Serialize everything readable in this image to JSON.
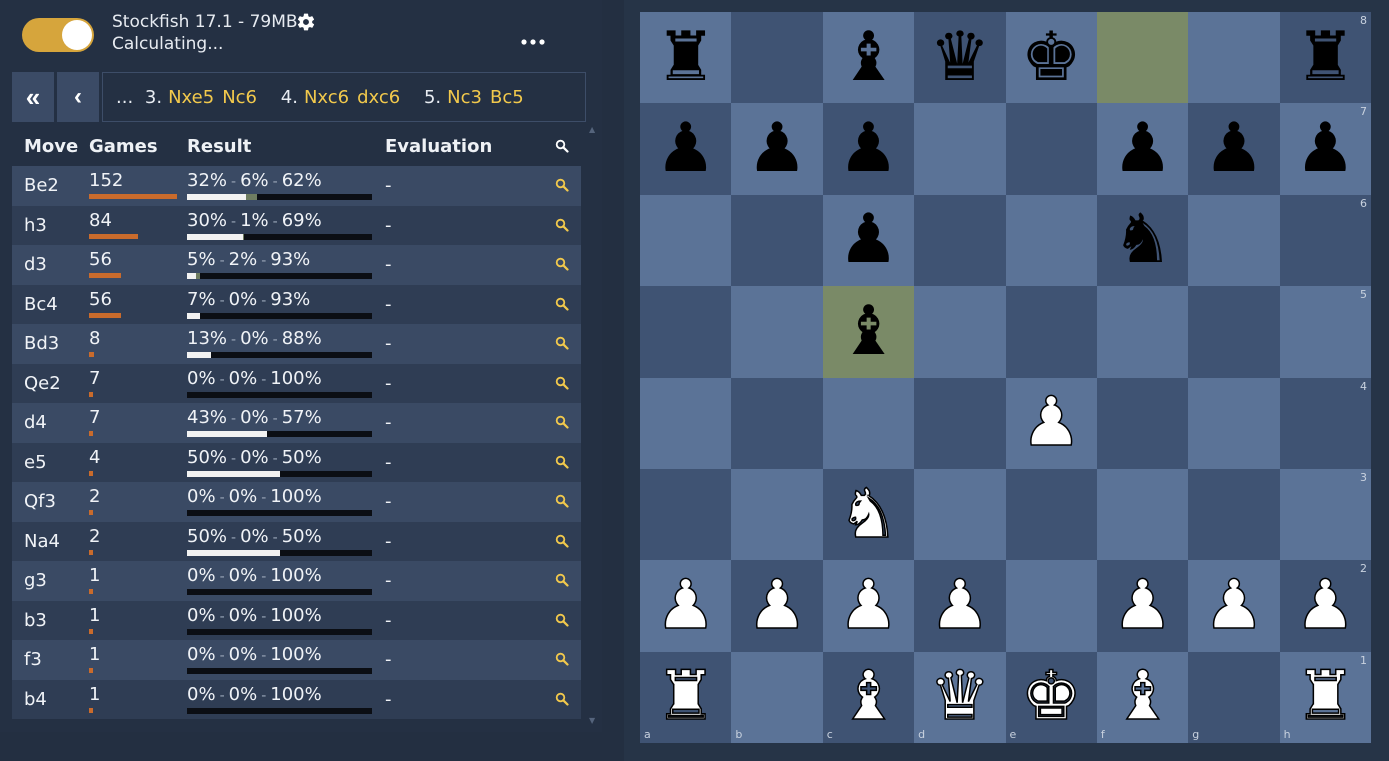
{
  "engine": {
    "name": "Stockfish 17.1 - 79MB",
    "status": "Calculating..."
  },
  "nav": {
    "first_label": "«",
    "prev_label": "‹"
  },
  "moves_line": {
    "ellipsis": "...",
    "moves": [
      {
        "num": "3.",
        "white": "Nxe5",
        "black": "Nc6"
      },
      {
        "num": "4.",
        "white": "Nxc6",
        "black": "dxc6"
      },
      {
        "num": "5.",
        "white": "Nc3",
        "black": "Bc5"
      }
    ]
  },
  "table": {
    "headers": {
      "move": "Move",
      "games": "Games",
      "result": "Result",
      "evaluation": "Evaluation"
    },
    "rows": [
      {
        "move": "Be2",
        "games": "152",
        "win": "32%",
        "draw": "6%",
        "loss": "62%",
        "eval": "-",
        "gfrac": 1.0,
        "w": 0.32,
        "d": 0.06
      },
      {
        "move": "h3",
        "games": "84",
        "win": "30%",
        "draw": "1%",
        "loss": "69%",
        "eval": "-",
        "gfrac": 0.553,
        "w": 0.3,
        "d": 0.01
      },
      {
        "move": "d3",
        "games": "56",
        "win": "5%",
        "draw": "2%",
        "loss": "93%",
        "eval": "-",
        "gfrac": 0.368,
        "w": 0.05,
        "d": 0.02
      },
      {
        "move": "Bc4",
        "games": "56",
        "win": "7%",
        "draw": "0%",
        "loss": "93%",
        "eval": "-",
        "gfrac": 0.368,
        "w": 0.07,
        "d": 0.0
      },
      {
        "move": "Bd3",
        "games": "8",
        "win": "13%",
        "draw": "0%",
        "loss": "88%",
        "eval": "-",
        "gfrac": 0.053,
        "w": 0.13,
        "d": 0.0
      },
      {
        "move": "Qe2",
        "games": "7",
        "win": "0%",
        "draw": "0%",
        "loss": "100%",
        "eval": "-",
        "gfrac": 0.046,
        "w": 0.0,
        "d": 0.0
      },
      {
        "move": "d4",
        "games": "7",
        "win": "43%",
        "draw": "0%",
        "loss": "57%",
        "eval": "-",
        "gfrac": 0.046,
        "w": 0.43,
        "d": 0.0
      },
      {
        "move": "e5",
        "games": "4",
        "win": "50%",
        "draw": "0%",
        "loss": "50%",
        "eval": "-",
        "gfrac": 0.026,
        "w": 0.5,
        "d": 0.0
      },
      {
        "move": "Qf3",
        "games": "2",
        "win": "0%",
        "draw": "0%",
        "loss": "100%",
        "eval": "-",
        "gfrac": 0.013,
        "w": 0.0,
        "d": 0.0
      },
      {
        "move": "Na4",
        "games": "2",
        "win": "50%",
        "draw": "0%",
        "loss": "50%",
        "eval": "-",
        "gfrac": 0.013,
        "w": 0.5,
        "d": 0.0
      },
      {
        "move": "g3",
        "games": "1",
        "win": "0%",
        "draw": "0%",
        "loss": "100%",
        "eval": "-",
        "gfrac": 0.007,
        "w": 0.0,
        "d": 0.0
      },
      {
        "move": "b3",
        "games": "1",
        "win": "0%",
        "draw": "0%",
        "loss": "100%",
        "eval": "-",
        "gfrac": 0.007,
        "w": 0.0,
        "d": 0.0
      },
      {
        "move": "f3",
        "games": "1",
        "win": "0%",
        "draw": "0%",
        "loss": "100%",
        "eval": "-",
        "gfrac": 0.007,
        "w": 0.0,
        "d": 0.0
      },
      {
        "move": "b4",
        "games": "1",
        "win": "0%",
        "draw": "0%",
        "loss": "100%",
        "eval": "-",
        "gfrac": 0.007,
        "w": 0.0,
        "d": 0.0
      }
    ]
  },
  "board": {
    "ranks": [
      "8",
      "7",
      "6",
      "5",
      "4",
      "3",
      "2",
      "1"
    ],
    "files": [
      "a",
      "b",
      "c",
      "d",
      "e",
      "f",
      "g",
      "h"
    ],
    "position": [
      [
        "r",
        "",
        "b",
        "q",
        "k",
        "",
        "",
        "r"
      ],
      [
        "p",
        "p",
        "p",
        "",
        "",
        "p",
        "p",
        "p"
      ],
      [
        "",
        "",
        "p",
        "",
        "",
        "n",
        "",
        ""
      ],
      [
        "",
        "",
        "b",
        "",
        "",
        "",
        "",
        ""
      ],
      [
        "",
        "",
        "",
        "",
        "P",
        "",
        "",
        ""
      ],
      [
        "",
        "",
        "N",
        "",
        "",
        "",
        "",
        ""
      ],
      [
        "P",
        "P",
        "P",
        "P",
        "",
        "P",
        "P",
        "P"
      ],
      [
        "R",
        "",
        "B",
        "Q",
        "K",
        "B",
        "",
        "R"
      ]
    ],
    "highlighted": [
      "f8",
      "c5"
    ],
    "colors": {
      "light": "#5b7397",
      "dark": "#3f5373",
      "highlight": "#7a8a67"
    }
  },
  "colors": {
    "toggle_on": "#d6a53c",
    "move_text": "#f2c94c",
    "games_bar": "#c96b2c",
    "search_icon": "#f2c94c"
  },
  "icons": {
    "settings": "gear-icon",
    "more": "more-dots-icon",
    "search": "search-icon"
  }
}
